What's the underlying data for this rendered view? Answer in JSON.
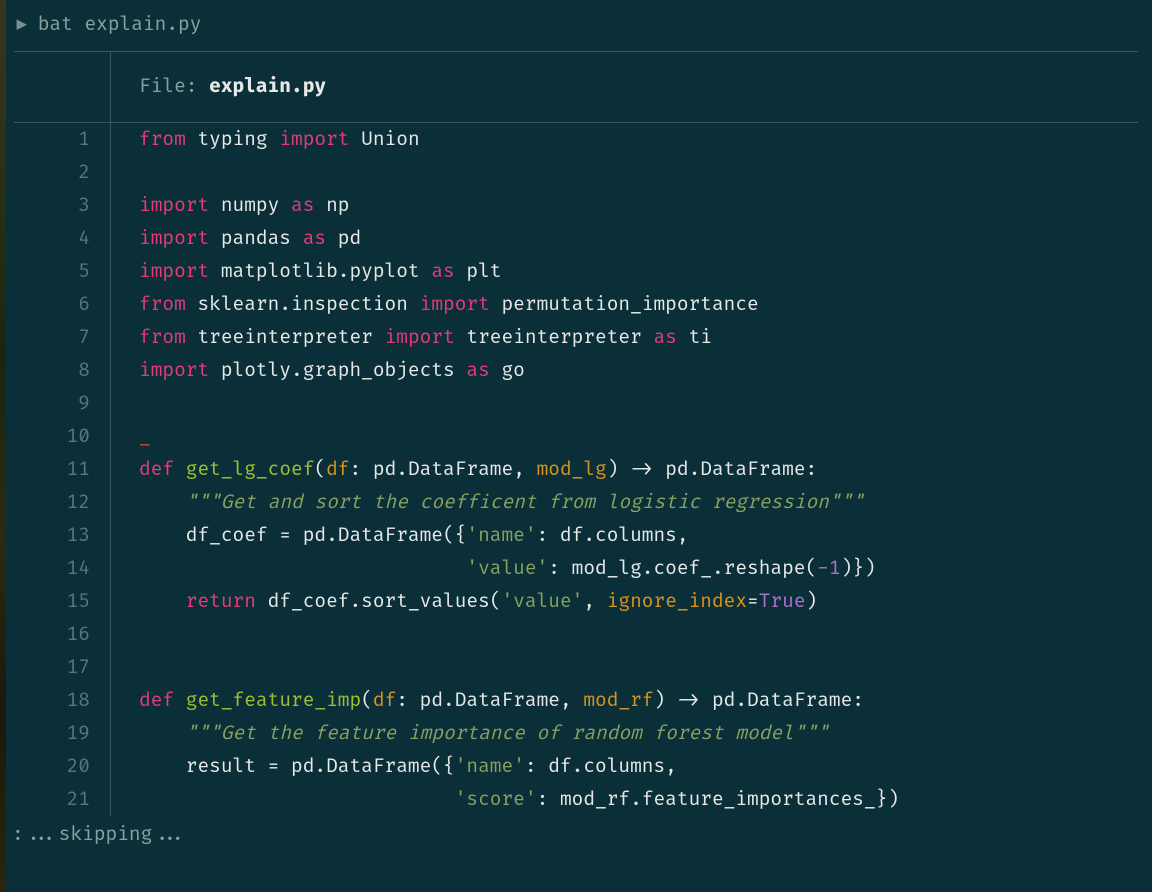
{
  "prompt": {
    "arrow": "▶",
    "command": "bat explain.py"
  },
  "file_header": {
    "label": "File: ",
    "name": "explain.py"
  },
  "lines": [
    {
      "num": "1",
      "tokens": [
        [
          "kw",
          "from"
        ],
        [
          "txt",
          " typing "
        ],
        [
          "kw",
          "import"
        ],
        [
          "txt",
          " Union"
        ]
      ]
    },
    {
      "num": "2",
      "tokens": []
    },
    {
      "num": "3",
      "tokens": [
        [
          "kw",
          "import"
        ],
        [
          "txt",
          " numpy "
        ],
        [
          "kw",
          "as"
        ],
        [
          "txt",
          " np"
        ]
      ]
    },
    {
      "num": "4",
      "tokens": [
        [
          "kw",
          "import"
        ],
        [
          "txt",
          " pandas "
        ],
        [
          "kw",
          "as"
        ],
        [
          "txt",
          " pd"
        ]
      ]
    },
    {
      "num": "5",
      "tokens": [
        [
          "kw",
          "import"
        ],
        [
          "txt",
          " matplotlib.pyplot "
        ],
        [
          "kw",
          "as"
        ],
        [
          "txt",
          " plt"
        ]
      ]
    },
    {
      "num": "6",
      "tokens": [
        [
          "kw",
          "from"
        ],
        [
          "txt",
          " sklearn.inspection "
        ],
        [
          "kw",
          "import"
        ],
        [
          "txt",
          " permutation_importance"
        ]
      ]
    },
    {
      "num": "7",
      "tokens": [
        [
          "kw",
          "from"
        ],
        [
          "txt",
          " treeinterpreter "
        ],
        [
          "kw",
          "import"
        ],
        [
          "txt",
          " treeinterpreter "
        ],
        [
          "kw",
          "as"
        ],
        [
          "txt",
          " ti"
        ]
      ]
    },
    {
      "num": "8",
      "tokens": [
        [
          "kw",
          "import"
        ],
        [
          "txt",
          " plotly.graph_objects "
        ],
        [
          "kw",
          "as"
        ],
        [
          "txt",
          " go"
        ]
      ]
    },
    {
      "num": "9",
      "tokens": []
    },
    {
      "num": "10",
      "tokens": [
        [
          "cursor",
          "_"
        ]
      ]
    },
    {
      "num": "11",
      "tokens": [
        [
          "kw",
          "def "
        ],
        [
          "fn",
          "get_lg_coef"
        ],
        [
          "txt",
          "("
        ],
        [
          "param",
          "df"
        ],
        [
          "txt",
          ": pd.DataFrame, "
        ],
        [
          "param",
          "mod_lg"
        ],
        [
          "txt",
          ") -> pd.DataFrame:"
        ]
      ]
    },
    {
      "num": "12",
      "tokens": [
        [
          "txt",
          "    "
        ],
        [
          "str",
          "\"\"\"Get and sort the coefficent from logistic regression\"\"\""
        ]
      ]
    },
    {
      "num": "13",
      "tokens": [
        [
          "txt",
          "    df_coef = pd.DataFrame({"
        ],
        [
          "strlit",
          "'name'"
        ],
        [
          "txt",
          ": df.columns,"
        ]
      ]
    },
    {
      "num": "14",
      "tokens": [
        [
          "txt",
          "                            "
        ],
        [
          "strlit",
          "'value'"
        ],
        [
          "txt",
          ": mod_lg.coef_.reshape("
        ],
        [
          "num",
          "-1"
        ],
        [
          "txt",
          ")})"
        ]
      ]
    },
    {
      "num": "15",
      "tokens": [
        [
          "txt",
          "    "
        ],
        [
          "kw",
          "return"
        ],
        [
          "txt",
          " df_coef.sort_values("
        ],
        [
          "strlit",
          "'value'"
        ],
        [
          "txt",
          ", "
        ],
        [
          "param",
          "ignore_index"
        ],
        [
          "txt",
          "="
        ],
        [
          "bool",
          "True"
        ],
        [
          "txt",
          ")"
        ]
      ]
    },
    {
      "num": "16",
      "tokens": []
    },
    {
      "num": "17",
      "tokens": []
    },
    {
      "num": "18",
      "tokens": [
        [
          "kw",
          "def "
        ],
        [
          "fn",
          "get_feature_imp"
        ],
        [
          "txt",
          "("
        ],
        [
          "param",
          "df"
        ],
        [
          "txt",
          ": pd.DataFrame, "
        ],
        [
          "param",
          "mod_rf"
        ],
        [
          "txt",
          ") -> pd.DataFrame:"
        ]
      ]
    },
    {
      "num": "19",
      "tokens": [
        [
          "txt",
          "    "
        ],
        [
          "str",
          "\"\"\"Get the feature importance of random forest model\"\"\""
        ]
      ]
    },
    {
      "num": "20",
      "tokens": [
        [
          "txt",
          "    result = pd.DataFrame({"
        ],
        [
          "strlit",
          "'name'"
        ],
        [
          "txt",
          ": df.columns,"
        ]
      ]
    },
    {
      "num": "21",
      "tokens": [
        [
          "txt",
          "                           "
        ],
        [
          "strlit",
          "'score'"
        ],
        [
          "txt",
          ": mod_rf.feature_importances_})"
        ]
      ]
    }
  ],
  "footer": ":...skipping..."
}
